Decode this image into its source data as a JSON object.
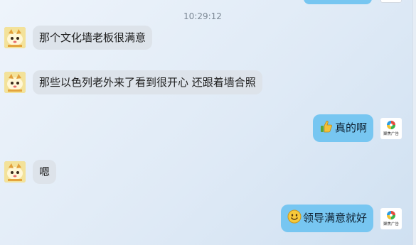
{
  "chat": {
    "timestamp": "10:29:12",
    "messages": [
      {
        "side": "left",
        "text": "那个文化墙老板很满意",
        "avatar_icon": "cartoon-cat-avatar-icon"
      },
      {
        "side": "left",
        "text": "那些以色列老外来了看到很开心 还跟着墙合照",
        "avatar_icon": "cartoon-cat-avatar-icon"
      },
      {
        "side": "right",
        "text": "真的啊",
        "emoji_icon": "thumbs-up-icon",
        "avatar_icon": "brand-logo-avatar-icon",
        "avatar_label": "聚焦广告"
      },
      {
        "side": "left",
        "text": "嗯",
        "avatar_icon": "cartoon-cat-avatar-icon"
      },
      {
        "side": "right",
        "text": "领导满意就好",
        "emoji_icon": "smiley-face-icon",
        "avatar_icon": "brand-logo-avatar-icon",
        "avatar_label": "聚焦广告"
      }
    ]
  },
  "colors": {
    "left_bubble": "#dde3ea",
    "right_bubble": "#77c6f1",
    "background": "#e4edf7"
  }
}
